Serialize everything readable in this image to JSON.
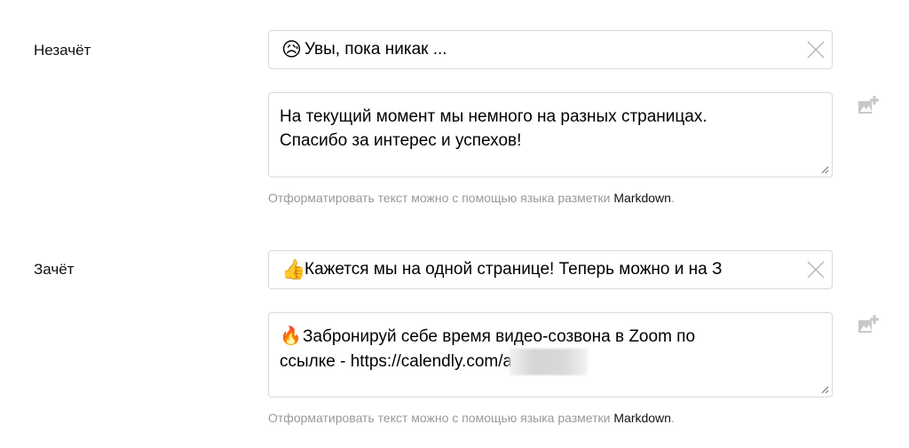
{
  "fail": {
    "label": "Незачёт",
    "title_emoji": "😥",
    "title_value": "Увы, пока никак ...",
    "body_line1": "На текущий момент мы немного на разных страницах.",
    "body_line2": "Спасибо за интерес и успехов!",
    "hint_text": "Отформатировать текст можно с помощью языка разметки ",
    "hint_link": "Markdown",
    "hint_end": "."
  },
  "pass": {
    "label": "Зачёт",
    "title_emoji": "👍",
    "title_value": "Кажется мы на одной странице! Теперь можно и на З",
    "body_emoji": "🔥",
    "body_line1": "Забронируй себе время видео-созвона в Zoom по",
    "body_line2": "ссылке - https://calendly.com/a",
    "hint_text": "Отформатировать текст можно с помощью языка разметки ",
    "hint_link": "Markdown",
    "hint_end": "."
  },
  "icons": {
    "clear": "close-icon",
    "add_image": "add-image-icon",
    "resize": "resize-handle-icon"
  },
  "colors": {
    "border": "#d9d9d9",
    "hint": "#999999",
    "icon": "#c4c4c4"
  }
}
